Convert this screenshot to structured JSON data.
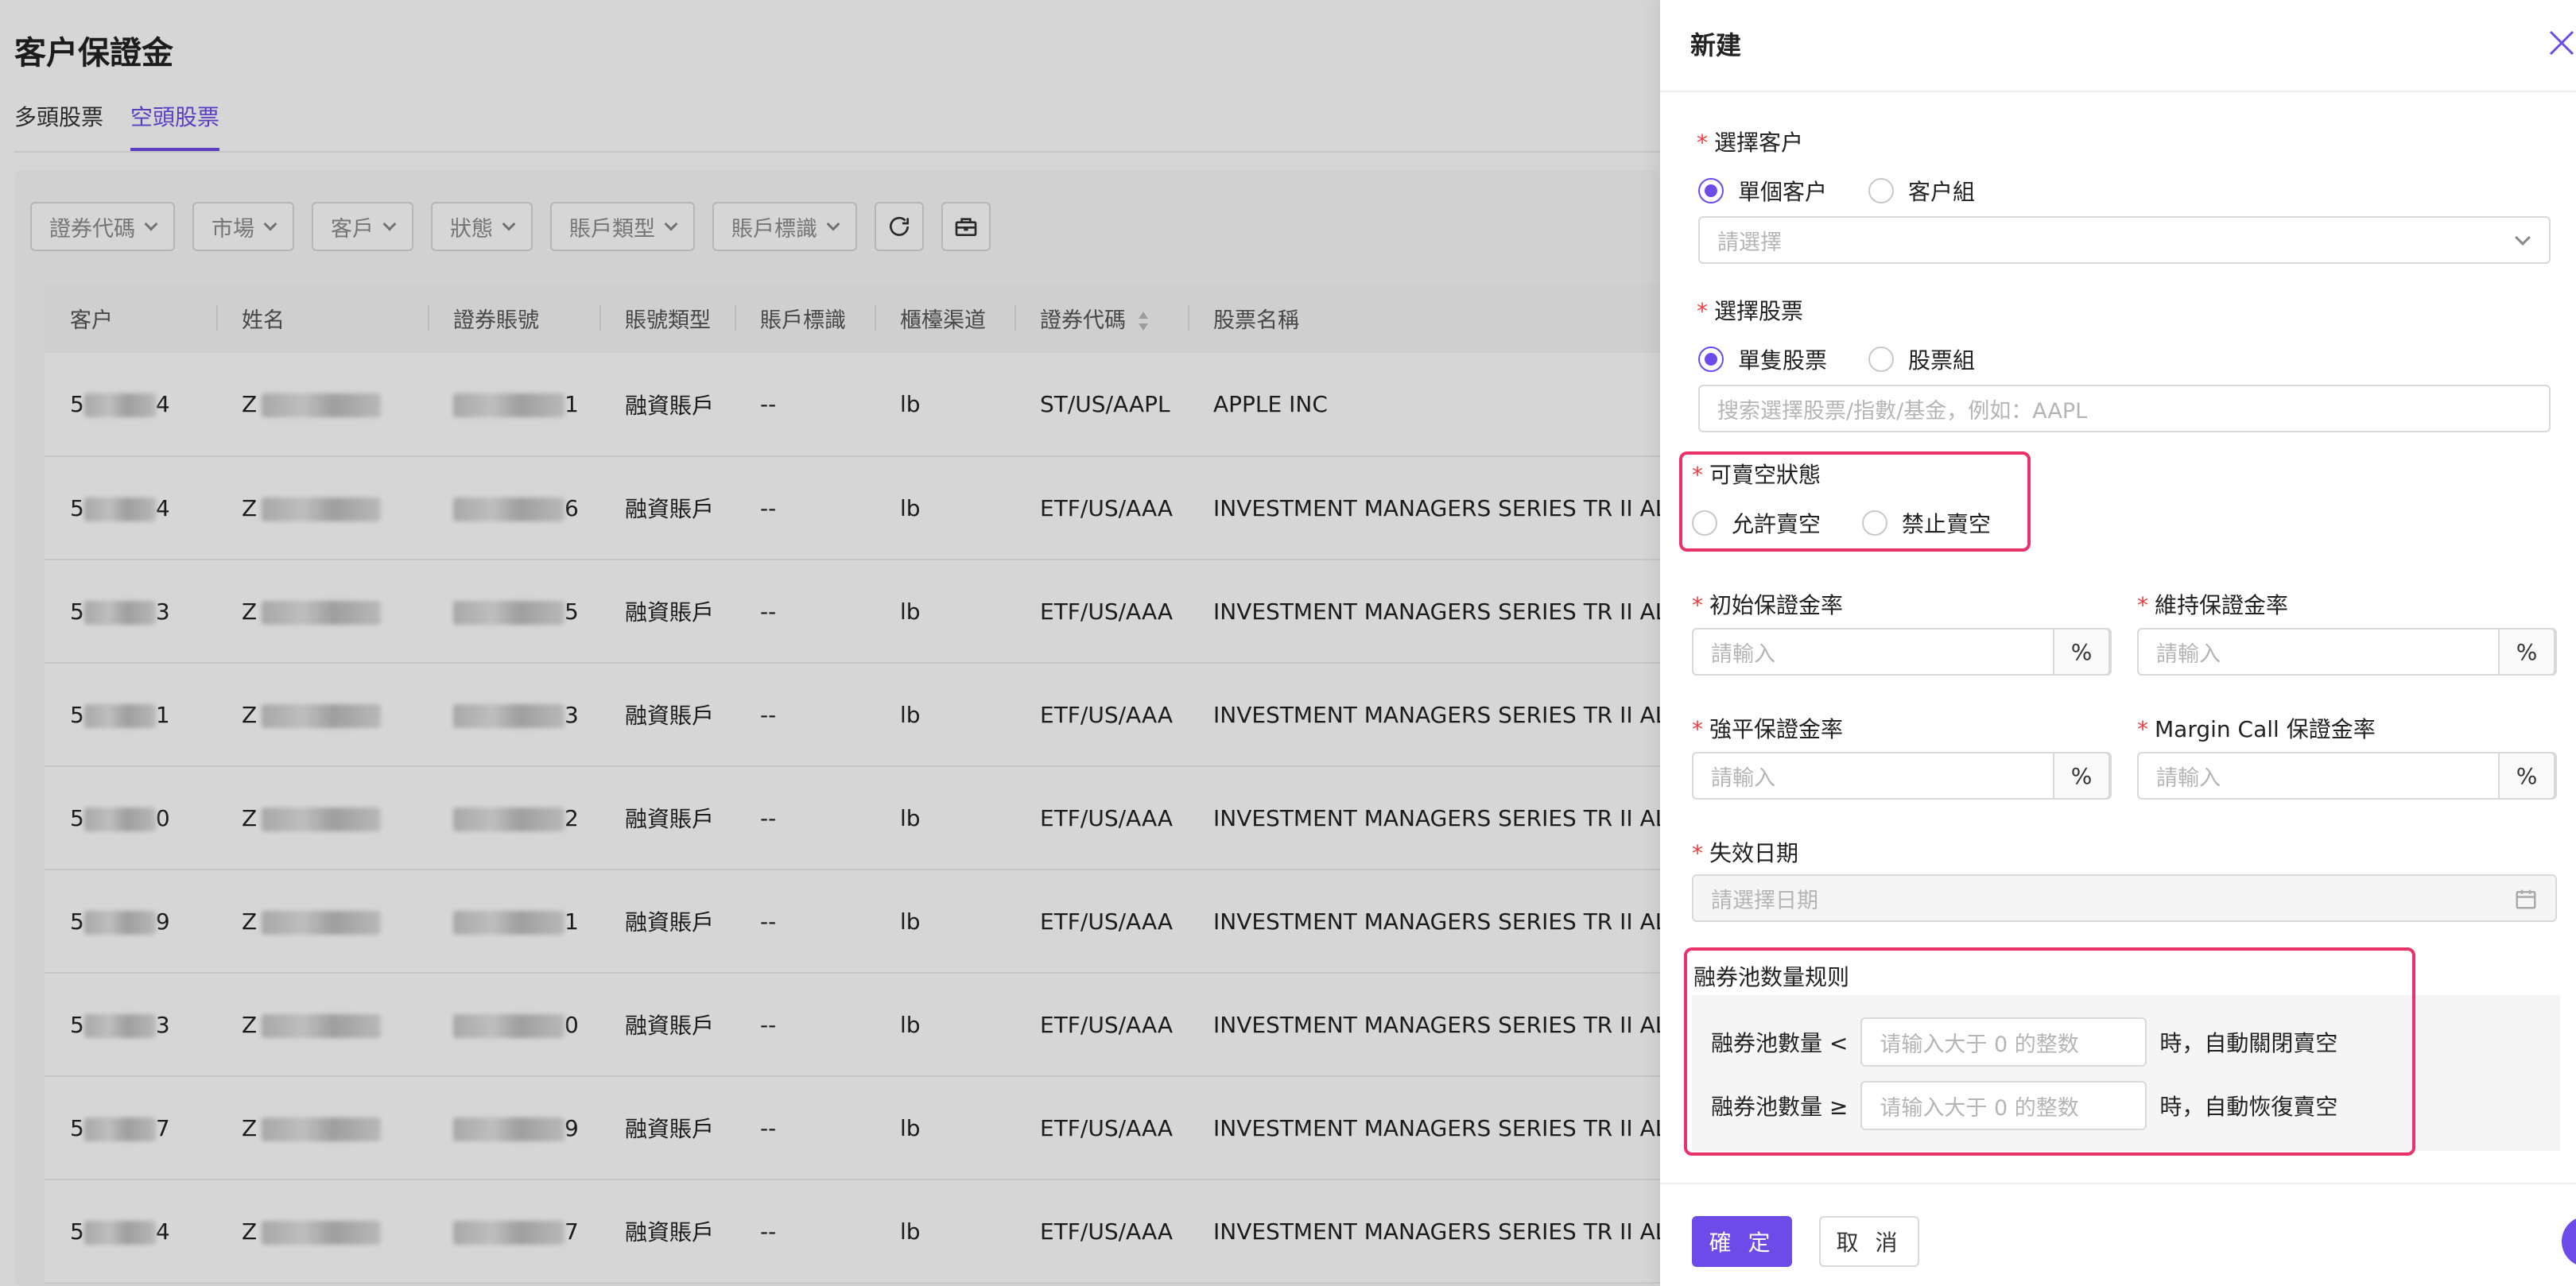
{
  "page": {
    "title": "客户保證金",
    "tabs": [
      {
        "label": "多頭股票",
        "active": false
      },
      {
        "label": "空頭股票",
        "active": true
      }
    ]
  },
  "filters": [
    "證券代碼",
    "市場",
    "客戶",
    "狀態",
    "賬戶類型",
    "賬戶標識"
  ],
  "toolbar_icons": [
    "refresh-icon",
    "toolbox-icon"
  ],
  "table": {
    "columns": [
      "客户",
      "姓名",
      "證券賬號",
      "賬號類型",
      "賬戶標識",
      "櫃檯渠道",
      "證券代碼",
      "股票名稱"
    ],
    "rows": [
      {
        "client_prefix": "5",
        "client_suffix": "4",
        "name_prefix": "Z",
        "account_suffix": "1",
        "account_type": "融資賬戶",
        "flag": "--",
        "channel": "lb",
        "code": "ST/US/AAPL",
        "stock_name": "APPLE INC"
      },
      {
        "client_prefix": "5",
        "client_suffix": "4",
        "name_prefix": "Z",
        "account_suffix": "6",
        "account_type": "融資賬戶",
        "flag": "--",
        "channel": "lb",
        "code": "ETF/US/AAA",
        "stock_name": "INVESTMENT MANAGERS SERIES TR II AL"
      },
      {
        "client_prefix": "5",
        "client_suffix": "3",
        "name_prefix": "Z",
        "account_suffix": "5",
        "account_type": "融資賬戶",
        "flag": "--",
        "channel": "lb",
        "code": "ETF/US/AAA",
        "stock_name": "INVESTMENT MANAGERS SERIES TR II AL"
      },
      {
        "client_prefix": "5",
        "client_suffix": "1",
        "name_prefix": "Z",
        "account_suffix": "3",
        "account_type": "融資賬戶",
        "flag": "--",
        "channel": "lb",
        "code": "ETF/US/AAA",
        "stock_name": "INVESTMENT MANAGERS SERIES TR II AL"
      },
      {
        "client_prefix": "5",
        "client_suffix": "0",
        "name_prefix": "Z",
        "account_suffix": "2",
        "account_type": "融資賬戶",
        "flag": "--",
        "channel": "lb",
        "code": "ETF/US/AAA",
        "stock_name": "INVESTMENT MANAGERS SERIES TR II AL"
      },
      {
        "client_prefix": "5",
        "client_suffix": "9",
        "name_prefix": "Z",
        "account_suffix": "1",
        "account_type": "融資賬戶",
        "flag": "--",
        "channel": "lb",
        "code": "ETF/US/AAA",
        "stock_name": "INVESTMENT MANAGERS SERIES TR II AL"
      },
      {
        "client_prefix": "5",
        "client_suffix": "3",
        "name_prefix": "Z",
        "account_suffix": "0",
        "account_type": "融資賬戶",
        "flag": "--",
        "channel": "lb",
        "code": "ETF/US/AAA",
        "stock_name": "INVESTMENT MANAGERS SERIES TR II AL"
      },
      {
        "client_prefix": "5",
        "client_suffix": "7",
        "name_prefix": "Z",
        "account_suffix": "9",
        "account_type": "融資賬戶",
        "flag": "--",
        "channel": "lb",
        "code": "ETF/US/AAA",
        "stock_name": "INVESTMENT MANAGERS SERIES TR II AL"
      },
      {
        "client_prefix": "5",
        "client_suffix": "4",
        "name_prefix": "Z",
        "account_suffix": "7",
        "account_type": "融資賬戶",
        "flag": "--",
        "channel": "lb",
        "code": "ETF/US/AAA",
        "stock_name": "INVESTMENT MANAGERS SERIES TR II AL"
      }
    ]
  },
  "drawer": {
    "title": "新建",
    "select_client": {
      "label": "選擇客户",
      "options": [
        "單個客户",
        "客户組"
      ],
      "selected": 0,
      "placeholder": "請選擇"
    },
    "select_stock": {
      "label": "選擇股票",
      "options": [
        "單隻股票",
        "股票組"
      ],
      "selected": 0,
      "placeholder": "搜索選擇股票/指數/基金，例如：AAPL"
    },
    "short_status": {
      "label": "可賣空狀態",
      "options": [
        "允許賣空",
        "禁止賣空"
      ]
    },
    "initial_margin": {
      "label": "初始保證金率",
      "placeholder": "請輸入",
      "suffix": "%"
    },
    "maintenance_margin": {
      "label": "維持保證金率",
      "placeholder": "請輸入",
      "suffix": "%"
    },
    "liquidation_margin": {
      "label": "強平保證金率",
      "placeholder": "請輸入",
      "suffix": "%"
    },
    "margin_call": {
      "label": "Margin Call 保證金率",
      "placeholder": "請輸入",
      "suffix": "%"
    },
    "expiry_date": {
      "label": "失效日期",
      "placeholder": "請選擇日期"
    },
    "pool_rule": {
      "title": "融券池数量规则",
      "less_label": "融券池數量 <",
      "less_placeholder": "请输入大于 0 的整数",
      "less_suffix": "時，自動關閉賣空",
      "gte_label": "融券池數量 ≥",
      "gte_placeholder": "请输入大于 0 的整数",
      "gte_suffix": "時，自動恢復賣空"
    },
    "confirm_label": "確 定",
    "cancel_label": "取 消"
  },
  "colors": {
    "accent": "#6c4be8",
    "required": "#f03e3e",
    "highlight": "#e8336a"
  }
}
